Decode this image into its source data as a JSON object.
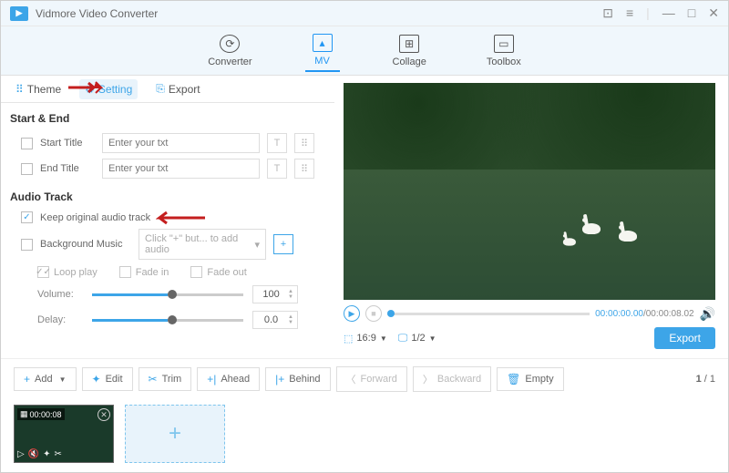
{
  "app_title": "Vidmore Video Converter",
  "topnav": {
    "converter": "Converter",
    "mv": "MV",
    "collage": "Collage",
    "toolbox": "Toolbox"
  },
  "tabs": {
    "theme": "Theme",
    "setting": "Setting",
    "export": "Export"
  },
  "sections": {
    "start_end": "Start & End",
    "audio_track": "Audio Track"
  },
  "start_end": {
    "start_label": "Start Title",
    "end_label": "End Title",
    "placeholder": "Enter your txt"
  },
  "audio": {
    "keep_original": "Keep original audio track",
    "bg_music": "Background Music",
    "bg_placeholder": "Click \"+\" but... to add audio",
    "loop": "Loop play",
    "fade_in": "Fade in",
    "fade_out": "Fade out",
    "volume_label": "Volume:",
    "volume_value": "100",
    "delay_label": "Delay:",
    "delay_value": "0.0"
  },
  "preview": {
    "time_current": "00:00:00.00",
    "time_total": "00:00:08.02",
    "aspect": "16:9",
    "zoom": "1/2",
    "export_btn": "Export"
  },
  "toolbar": {
    "add": "Add",
    "edit": "Edit",
    "trim": "Trim",
    "ahead": "Ahead",
    "behind": "Behind",
    "forward": "Forward",
    "backward": "Backward",
    "empty": "Empty"
  },
  "pagination": {
    "current": "1",
    "total": "1"
  },
  "thumb": {
    "duration": "00:00:08"
  }
}
